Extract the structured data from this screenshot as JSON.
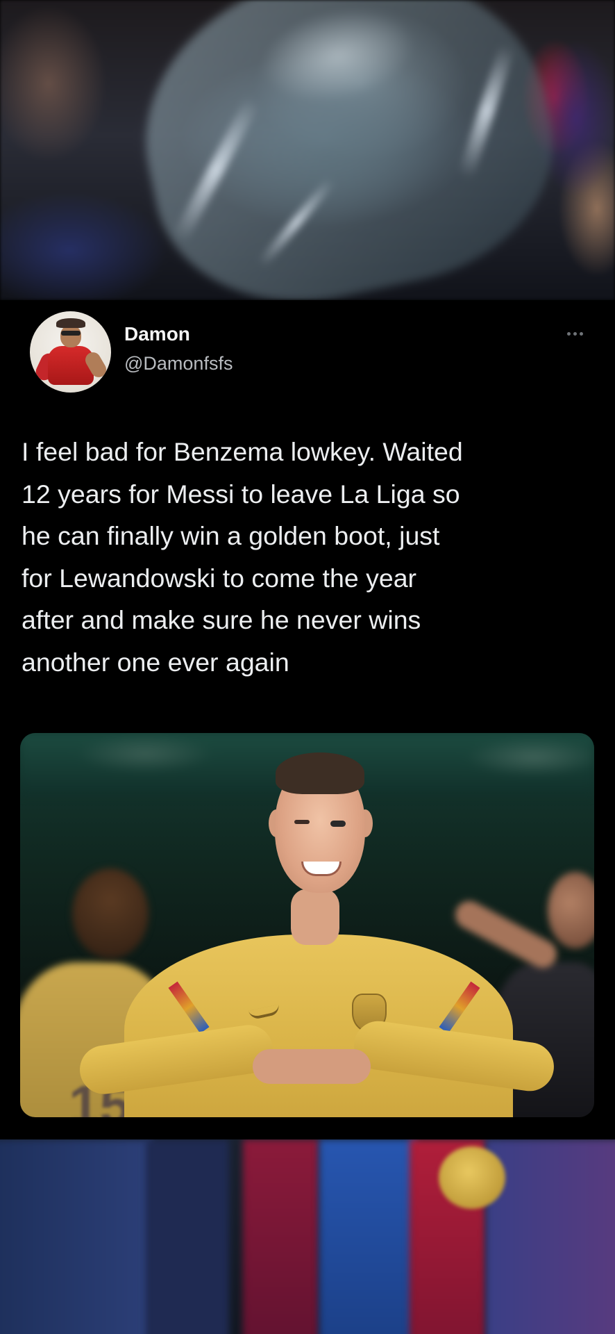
{
  "tweet": {
    "author": {
      "name": "Damon",
      "handle": "@Damonfsfs"
    },
    "text_lines": [
      "I feel bad for Benzema lowkey. Waited",
      "12 years for Messi to leave La Liga so",
      "he can finally win a golden boot, just",
      "for Lewandowski to come the year",
      "after and make sure he never wins",
      "another one ever again"
    ],
    "more_icon": "more-horizontal-icon"
  },
  "colors": {
    "background": "#000000",
    "name_text": "#f4f4f4",
    "handle_text": "#b9bcc0",
    "body_text": "#eceef0",
    "icon_gray": "#6f7378"
  }
}
